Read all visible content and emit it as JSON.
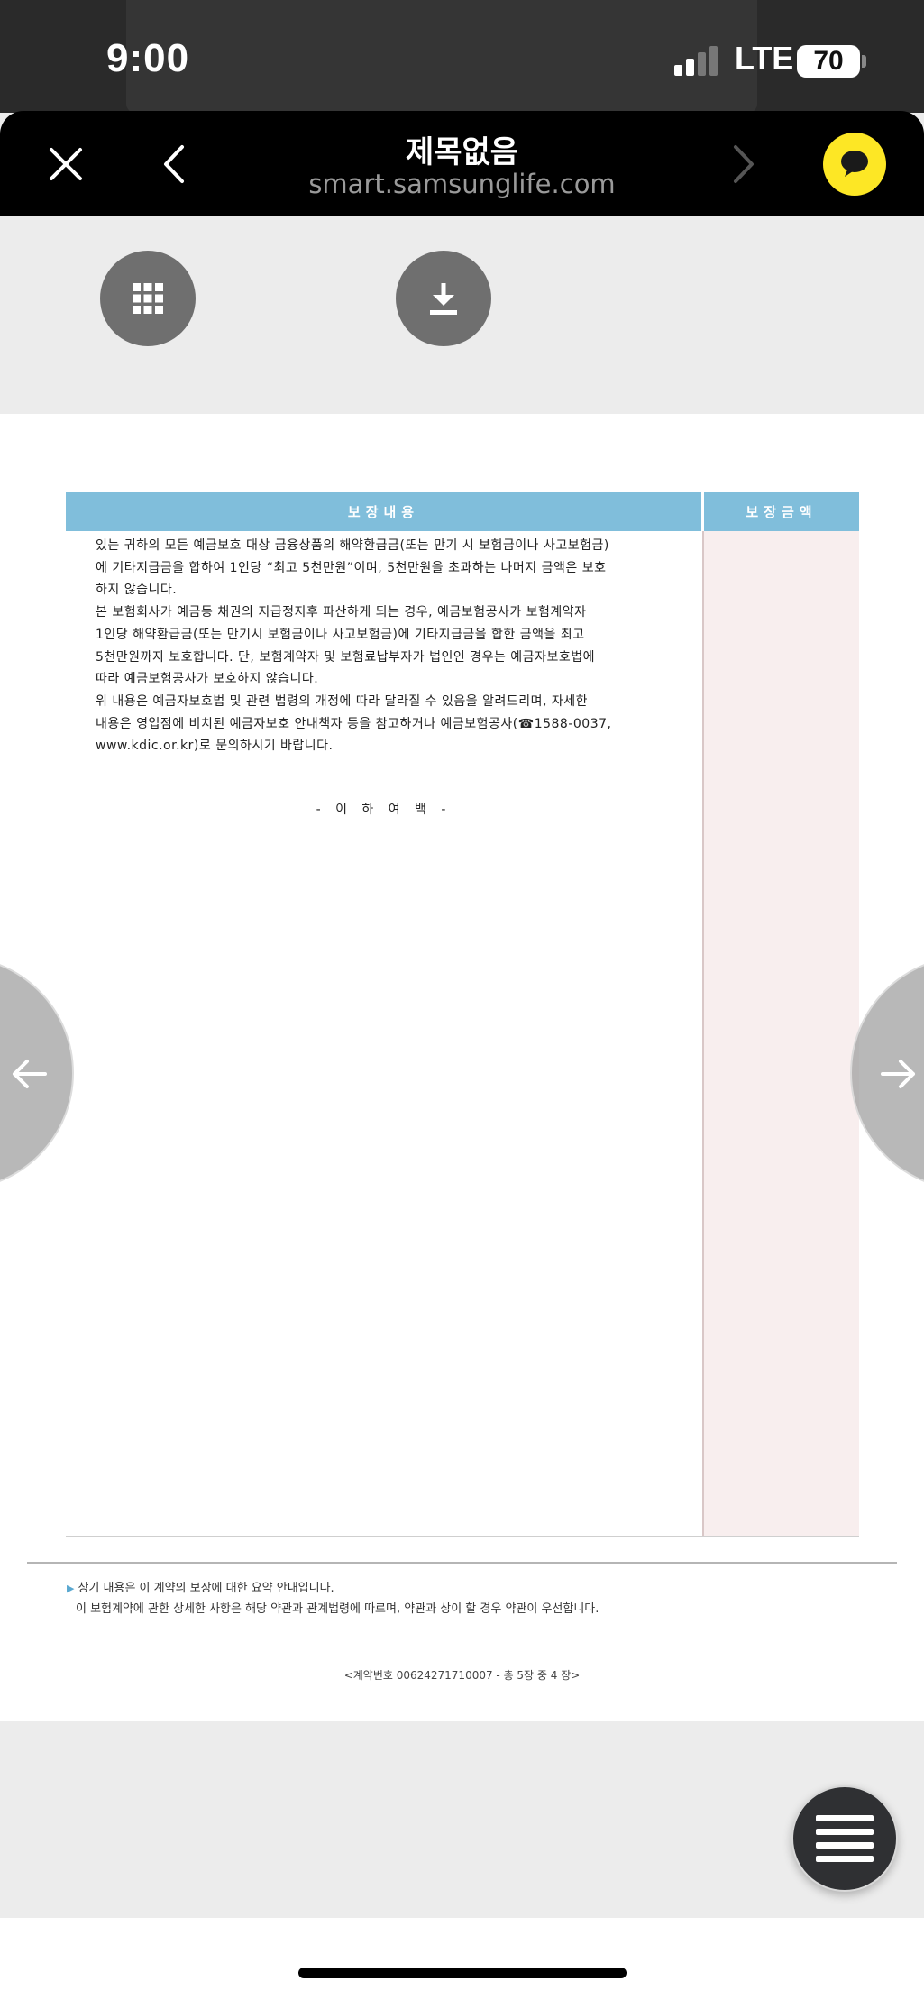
{
  "status_bar": {
    "time": "9:00",
    "network": "LTE",
    "battery": "70"
  },
  "browser": {
    "title": "제목없음",
    "url": "smart.samsunglife.com",
    "close_icon": "close-icon",
    "back_icon": "chevron-left-icon",
    "forward_icon": "chevron-right-icon",
    "chat_icon": "kakao-chat-icon"
  },
  "toolbar": {
    "grid_icon": "grid-icon",
    "download_icon": "download-icon"
  },
  "document": {
    "table_headers": {
      "content": "보장내용",
      "amount": "보장금액"
    },
    "body_lines": [
      "있는 귀하의 모든 예금보호 대상 금융상품의 해약환급금(또는 만기 시 보험금이나 사고보험금)",
      "에 기타지급금을 합하여 1인당 “최고 5천만원”이며, 5천만원을 초과하는 나머지 금액은 보호",
      "하지 않습니다.",
      "본  보험회사가 예금등 채권의 지급정지후 파산하게 되는 경우, 예금보험공사가 보험계약자",
      "1인당 해약환급금(또는 만기시 보험금이나 사고보험금)에 기타지급금을 합한 금액을 최고",
      "5천만원까지 보호합니다.  단, 보험계약자 및 보험료납부자가 법인인 경우는 예금자보호법에",
      "따라 예금보험공사가 보호하지 않습니다.",
      "위 내용은 예금자보호법 및 관련 법령의 개정에 따라 달라질 수 있음을 알려드리며, 자세한",
      "내용은 영업점에 비치된 예금자보호 안내책자 등을 참고하거나 예금보험공사(☎1588-0037,",
      "www.kdic.or.kr)로 문의하시기 바랍니다."
    ],
    "end_mark": "- 이 하 여 백 -",
    "footnote_line1": "상기 내용은 이 계약의 보장에 대한 요약 안내입니다.",
    "footnote_line2": "이 보험계약에 관한 상세한 사항은 해당 약관과 관계법령에 따르며, 약관과 상이 할 경우 약관이 우선합니다.",
    "contract_no": "<계약번호 00624271710007 - 총 5장 중  4 장>"
  },
  "nav": {
    "prev_icon": "arrow-left-icon",
    "next_icon": "arrow-right-icon",
    "menu_icon": "hamburger-menu-icon"
  },
  "colors": {
    "header_blue": "#80bedb",
    "amount_pink": "#f8eeee",
    "kakao_yellow": "#fde725"
  }
}
